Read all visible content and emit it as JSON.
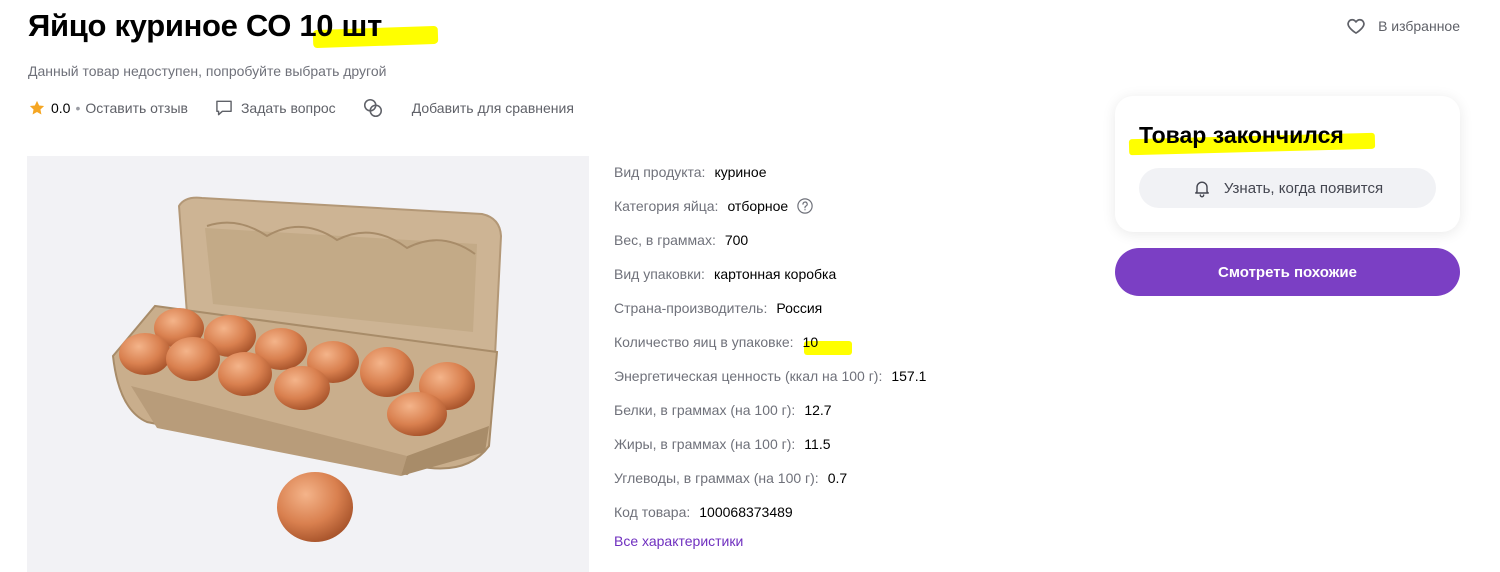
{
  "product": {
    "title": "Яйцо куриное СО 10 шт",
    "unavailable_text": "Данный товар недоступен, попробуйте выбрать другой"
  },
  "favorite": {
    "label": "В избранное",
    "icon": "heart-icon"
  },
  "actions": {
    "rating": "0.0",
    "separator": "•",
    "review_label": "Оставить отзыв",
    "ask_label": "Задать вопрос",
    "compare_label": "Добавить для сравнения"
  },
  "specs": [
    {
      "label": "Вид продукта:",
      "value": "куриное"
    },
    {
      "label": "Категория яйца:",
      "value": "отборное"
    },
    {
      "label": "Вес, в граммах:",
      "value": "700"
    },
    {
      "label": "Вид упаковки:",
      "value": "картонная коробка"
    },
    {
      "label": "Страна-производитель:",
      "value": "Россия"
    },
    {
      "label": "Количество яиц в упаковке:",
      "value": "10"
    },
    {
      "label": "Энергетическая ценность (ккал на 100 г):",
      "value": "157.1"
    },
    {
      "label": "Белки, в граммах (на 100 г):",
      "value": "12.7"
    },
    {
      "label": "Жиры, в граммах (на 100 г):",
      "value": "11.5"
    },
    {
      "label": "Углеводы, в граммах (на 100 г):",
      "value": "0.7"
    },
    {
      "label": "Код товара:",
      "value": "100068373489"
    }
  ],
  "all_specs_link": "Все характеристики",
  "stock": {
    "title": "Товар закончился",
    "notify_label": "Узнать, когда появится"
  },
  "similar_button": "Смотреть похожие",
  "colors": {
    "accent": "#7b3fc4",
    "link": "#6f2fbf",
    "highlight": "#ffff00",
    "star": "#f5a623"
  }
}
